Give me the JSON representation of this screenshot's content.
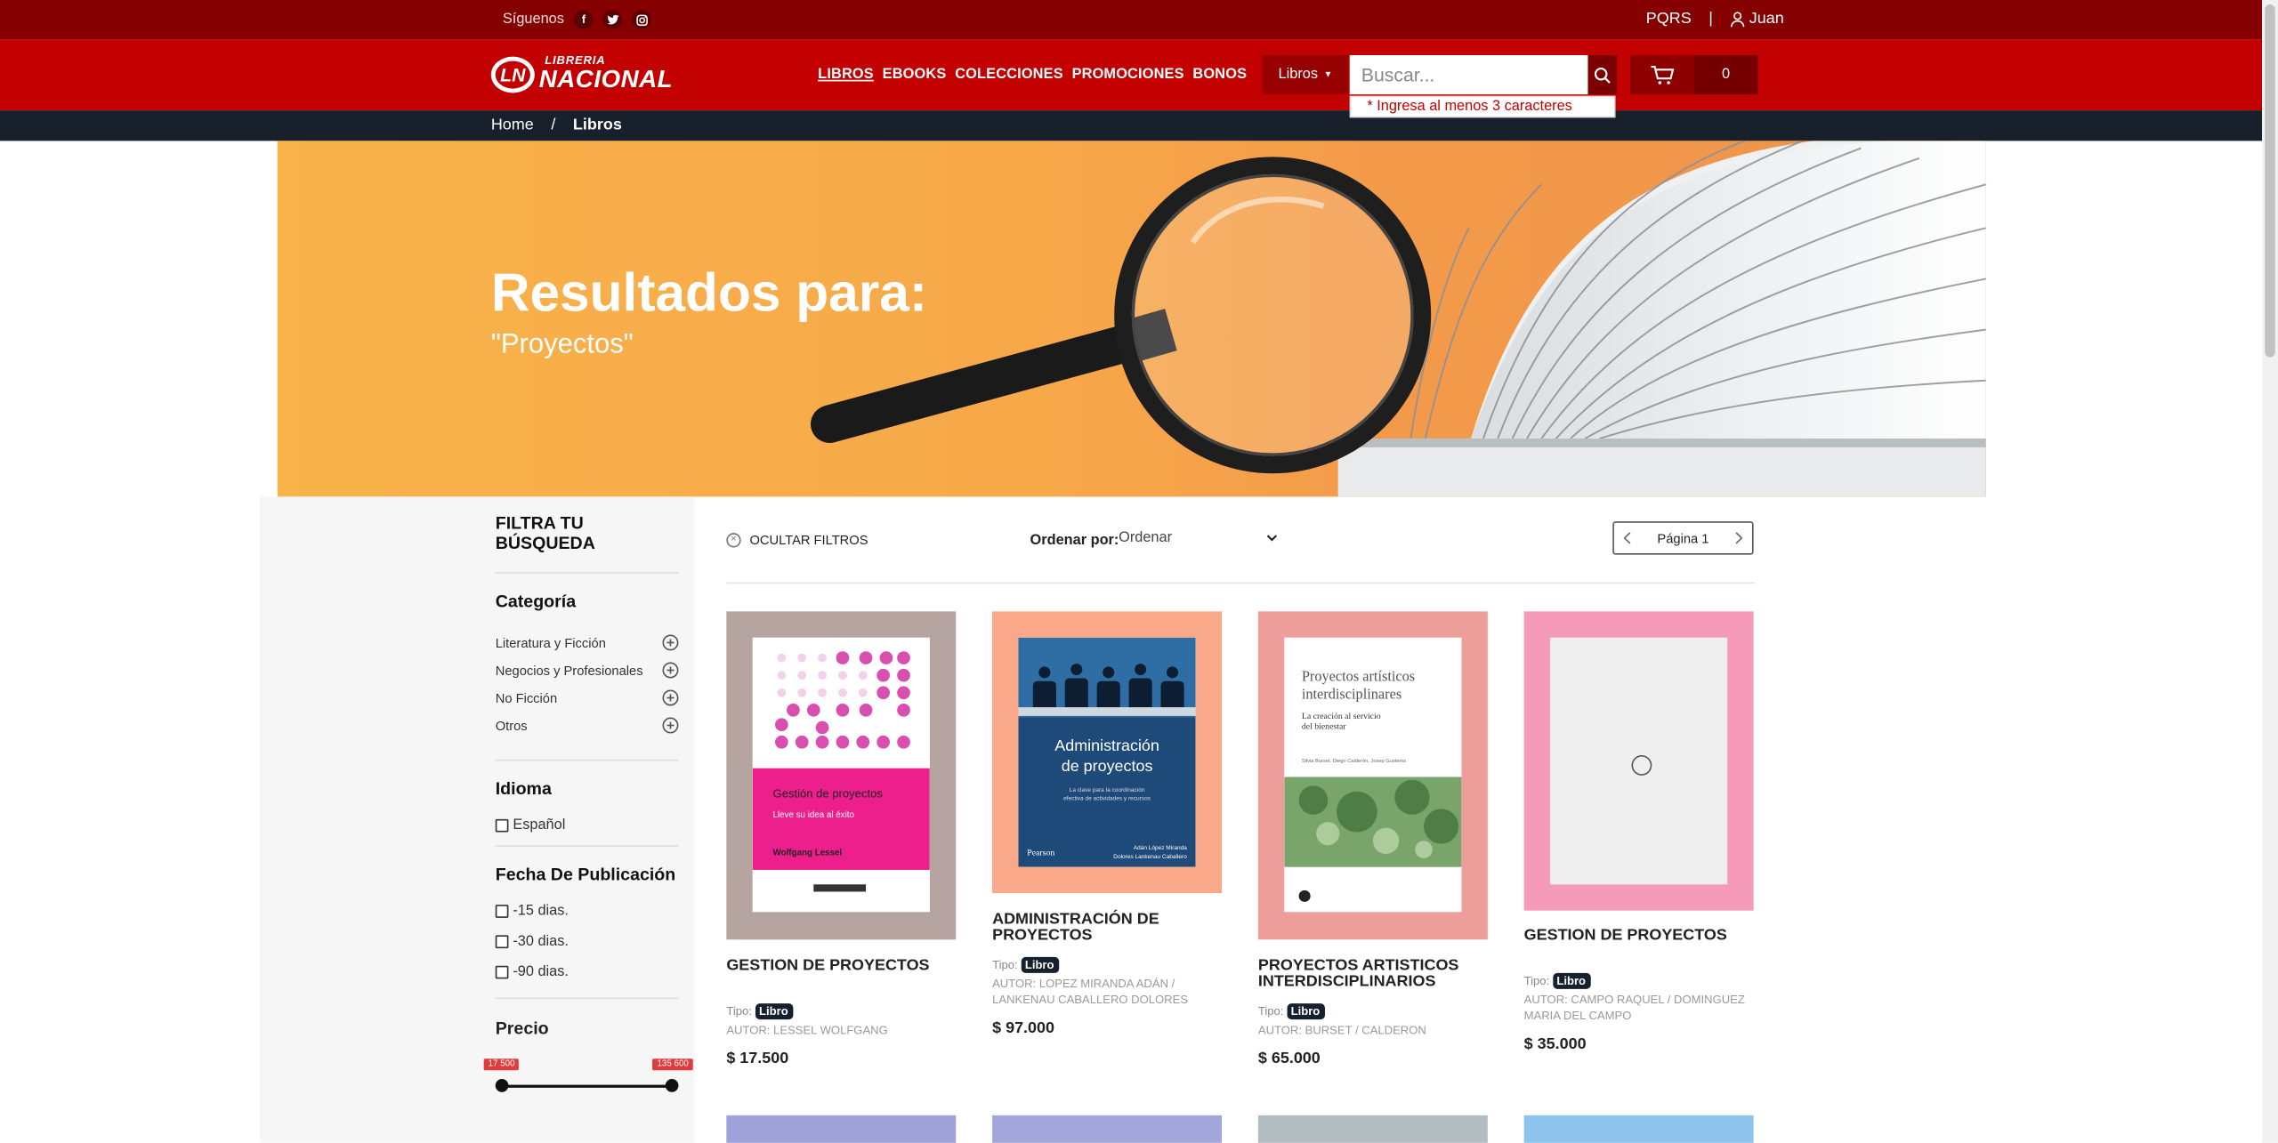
{
  "topbar": {
    "follow_label": "Síguenos",
    "social": [
      {
        "name": "facebook",
        "glyph": "f"
      },
      {
        "name": "twitter",
        "glyph": "t"
      },
      {
        "name": "instagram",
        "glyph": "◎"
      }
    ],
    "pqrs_label": "PQRS",
    "separator": "|",
    "user_name": "Juan"
  },
  "header": {
    "logo_small": "LIBRERIA",
    "logo_big": "NACIONAL",
    "nav": [
      "LIBROS",
      "EBOOKS",
      "COLECCIONES",
      "PROMOCIONES",
      "BONOS"
    ],
    "active_nav": "LIBROS",
    "search_scope": "Libros",
    "search_placeholder": "Buscar...",
    "search_value": "",
    "search_hint": "* Ingresa al menos 3 caracteres",
    "cart_count": "0"
  },
  "breadcrumb": {
    "home": "Home",
    "separator": "/",
    "current": "Libros"
  },
  "banner": {
    "title": "Resultados para:",
    "query": "\"Proyectos\""
  },
  "filters": {
    "title": "FILTRA TU BÚSQUEDA",
    "category_title": "Categoría",
    "categories": [
      "Literatura y Ficción",
      "Negocios y Profesionales",
      "No Ficción",
      "Otros"
    ],
    "language_title": "Idioma",
    "languages": [
      "Español"
    ],
    "date_title": "Fecha De Publicación",
    "dates": [
      "-15 dias.",
      "-30 dias.",
      "-90 dias."
    ],
    "price_title": "Precio",
    "price_min": "17 500",
    "price_max": "135 600"
  },
  "controls": {
    "hide_filters": "OCULTAR FILTROS",
    "sort_label": "Ordenar por:",
    "sort_value": "Ordenar",
    "page_label": "Página 1"
  },
  "products": [
    {
      "name": "GESTION DE PROYECTOS",
      "type_label": "Tipo:",
      "type": "Libro",
      "author": "Autor: LESSEL WOLFGANG",
      "price": "$ 17.500",
      "frame_color": "#b5a4a0",
      "cover_title": "Gestión de proyectos",
      "cover_sub": "Lleve su idea al éxito",
      "cover_author": "Wolfgang Lessel"
    },
    {
      "name": "ADMINISTRACIÓN DE PROYECTOS",
      "type_label": "Tipo:",
      "type": "Libro",
      "author": "Autor: LOPEZ MIRANDA ADÁN / LANKENAU CABALLERO DOLORES",
      "price": "$ 97.000",
      "frame_color": "#f9a889",
      "cover_title": "Administración de proyectos",
      "cover_sub": "La clave para la coordinación efectiva de actividades y recursos",
      "cover_publisher": "Pearson",
      "cover_authors": "Adán López Miranda / Dolores Lankenau Caballero"
    },
    {
      "name": "PROYECTOS ARTISTICOS INTERDISCIPLINARIOS",
      "type_label": "Tipo:",
      "type": "Libro",
      "author": "Autor: BURSET / CALDERON",
      "price": "$ 65.000",
      "frame_color": "#ee9e9a",
      "cover_title": "Proyectos artísticos interdisciplinares",
      "cover_sub": "La creación al servicio del bienestar",
      "cover_authors": "Silvia Burset, Diego Calderón, Josep Gustems"
    },
    {
      "name": "GESTION DE PROYECTOS",
      "type_label": "Tipo:",
      "type": "Libro",
      "author": "Autor: CAMPO RAQUEL / DOMINGUEZ MARIA DEL CAMPO",
      "price": "$ 35.000",
      "frame_color": "#f59ab8"
    }
  ],
  "next_row_colors": [
    "#9fa2d8",
    "#a2a6da",
    "#b2bcc1",
    "#8ec3ee"
  ],
  "colors": {
    "topbar": "#850000",
    "header": "#c30000",
    "breadcrumb": "#18202c",
    "accent": "#c30000"
  }
}
